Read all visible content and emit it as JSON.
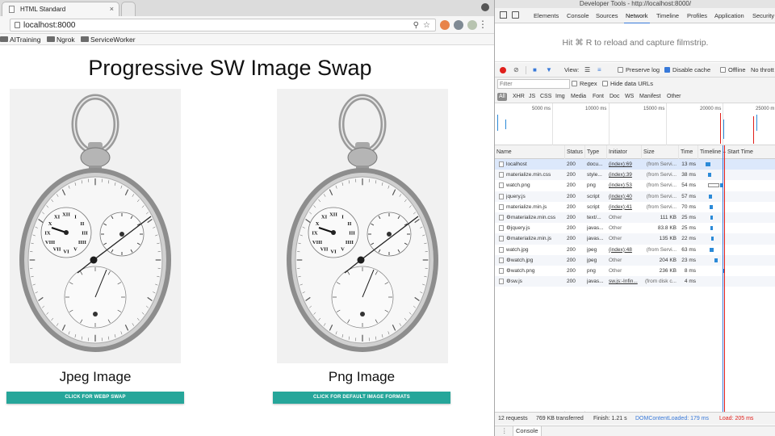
{
  "browser": {
    "tab_title": "HTML Standard",
    "tab_close": "×",
    "url": "localhost:8000",
    "bookmarks": [
      "AITraining",
      "Ngrok",
      "ServiceWorker"
    ]
  },
  "page": {
    "title": "Progressive SW Image Swap",
    "jpeg_label": "Jpeg Image",
    "png_label": "Png Image",
    "webp_button": "CLICK FOR WEBP SWAP",
    "default_button": "CLICK FOR DEFAULT IMAGE FORMATS"
  },
  "devtools": {
    "window_title": "Developer Tools - http://localhost:8000/",
    "tabs": [
      "Elements",
      "Console",
      "Sources",
      "Network",
      "Timeline",
      "Profiles",
      "Application",
      "Security"
    ],
    "active_tab": "Network",
    "filmstrip_message": "Hit ⌘ R to reload and capture filmstrip.",
    "toolbar": {
      "view_label": "View:",
      "preserve_log": "Preserve log",
      "disable_cache": "Disable cache",
      "offline": "Offline",
      "throttling": "No thrott"
    },
    "filter_placeholder": "Filter",
    "regex_label": "Regex",
    "hide_data_urls": "Hide data URLs",
    "type_filters": [
      "All",
      "XHR",
      "JS",
      "CSS",
      "Img",
      "Media",
      "Font",
      "Doc",
      "WS",
      "Manifest",
      "Other"
    ],
    "overview_ticks": [
      "5000 ms",
      "10000 ms",
      "15000 ms",
      "20000 ms",
      "25000 m"
    ],
    "columns": [
      "Name",
      "Status",
      "Type",
      "Initiator",
      "Size",
      "Time",
      "Timeline – Start Time"
    ],
    "rows": [
      {
        "name": "localhost",
        "status": "200",
        "type": "docu...",
        "initiator": "(index):69",
        "size": "(from Servi...",
        "time": "13 ms"
      },
      {
        "name": "materialize.min.css",
        "status": "200",
        "type": "style...",
        "initiator": "(index):39",
        "size": "(from Servi...",
        "time": "38 ms"
      },
      {
        "name": "watch.png",
        "status": "200",
        "type": "png",
        "initiator": "(index):53",
        "size": "(from Servi...",
        "time": "54 ms"
      },
      {
        "name": "jquery.js",
        "status": "200",
        "type": "script",
        "initiator": "(index):40",
        "size": "(from Servi...",
        "time": "57 ms"
      },
      {
        "name": "materialize.min.js",
        "status": "200",
        "type": "script",
        "initiator": "(index):41",
        "size": "(from Servi...",
        "time": "70 ms"
      },
      {
        "name": "⚙materialize.min.css",
        "status": "200",
        "type": "text/...",
        "initiator": "Other",
        "size": "111 KB",
        "time": "25 ms"
      },
      {
        "name": "⚙jquery.js",
        "status": "200",
        "type": "javas...",
        "initiator": "Other",
        "size": "83.8 KB",
        "time": "25 ms"
      },
      {
        "name": "⚙materialize.min.js",
        "status": "200",
        "type": "javas...",
        "initiator": "Other",
        "size": "135 KB",
        "time": "22 ms"
      },
      {
        "name": "watch.jpg",
        "status": "200",
        "type": "jpeg",
        "initiator": "(index):48",
        "size": "(from Servi...",
        "time": "63 ms"
      },
      {
        "name": "⚙watch.jpg",
        "status": "200",
        "type": "jpeg",
        "initiator": "Other",
        "size": "204 KB",
        "time": "23 ms"
      },
      {
        "name": "⚙watch.png",
        "status": "200",
        "type": "png",
        "initiator": "Other",
        "size": "236 KB",
        "time": "8 ms"
      },
      {
        "name": "⚙sw.js",
        "status": "200",
        "type": "javas...",
        "initiator": "sw.js:-Infin...",
        "size": "(from disk c...",
        "time": "4 ms"
      }
    ],
    "status": {
      "requests": "12 requests",
      "transferred": "769 KB transferred",
      "finish": "Finish: 1.21 s",
      "dom_content_loaded": "DOMContentLoaded: 179 ms",
      "load": "Load: 205 ms"
    },
    "drawer_tab": "Console",
    "colors": {
      "accent": "#3879d9",
      "record": "#e0201c",
      "button": "#26a69a",
      "load": "#e0201c"
    }
  }
}
